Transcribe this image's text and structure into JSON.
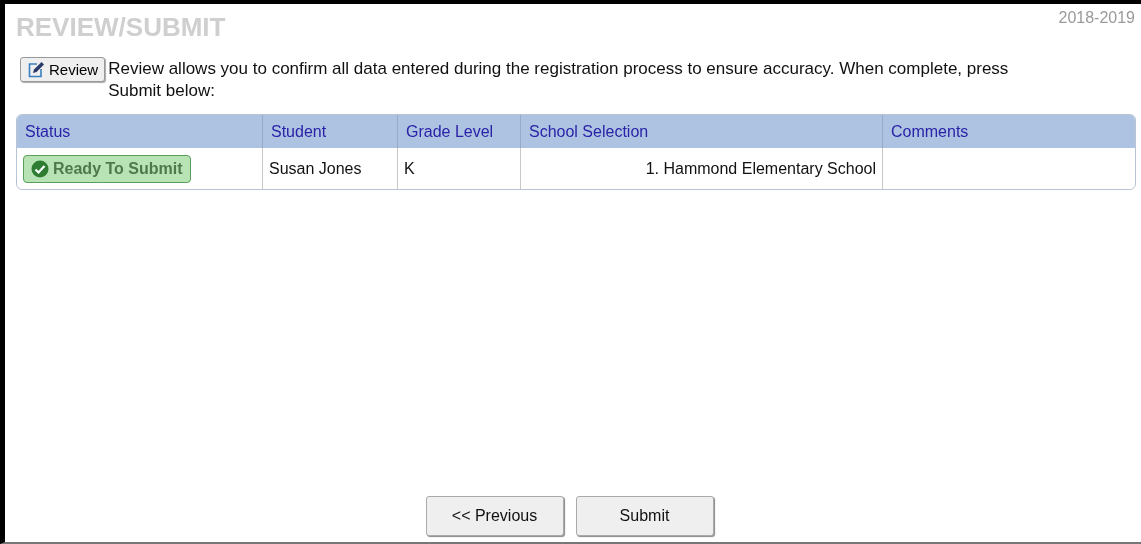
{
  "title": "REVIEW/SUBMIT",
  "year": "2018-2019",
  "review_button": {
    "label": "Review"
  },
  "description": "Review allows you to confirm all data entered during the registration process to ensure accuracy. When complete, press Submit below:",
  "table": {
    "columns": [
      "Status",
      "Student",
      "Grade Level",
      "School Selection",
      "Comments"
    ],
    "rows": [
      {
        "status": {
          "label": "Ready To Submit",
          "kind": "ready"
        },
        "student": "Susan Jones",
        "grade": "K",
        "school": "1. Hammond Elementary School"
      }
    ]
  },
  "buttons": [
    "<< Previous",
    "Submit"
  ]
}
